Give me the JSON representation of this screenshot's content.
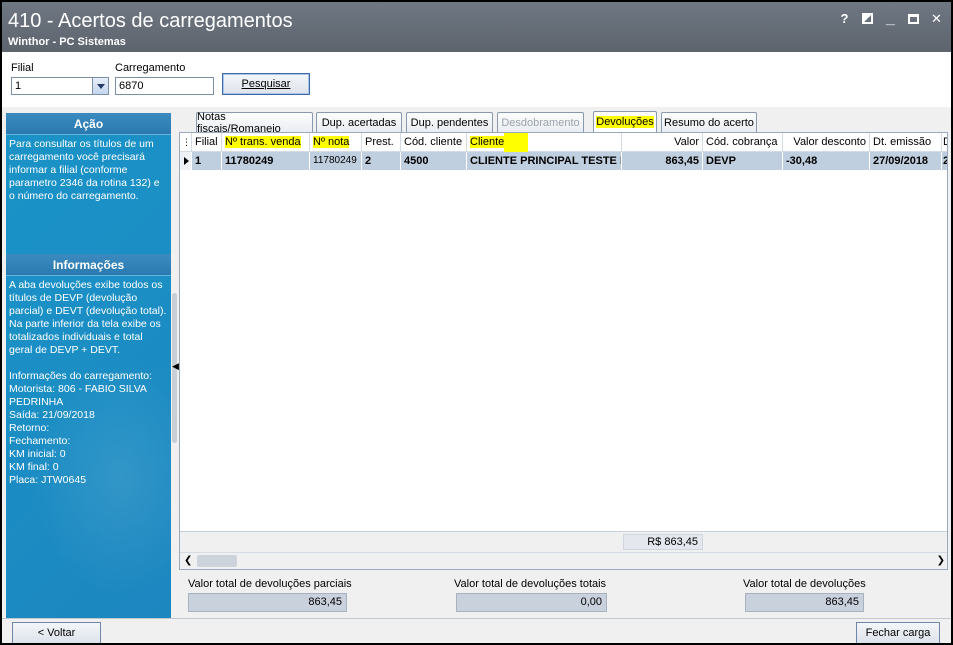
{
  "window": {
    "title": "410 - Acertos de carregamentos",
    "subtitle": "Winthor - PC Sistemas",
    "help_glyph": "?",
    "close_glyph": "✕"
  },
  "filters": {
    "filial_label": "Filial",
    "filial_value": "1",
    "carregamento_label": "Carregamento",
    "carregamento_value": "6870",
    "search_button": "Pesquisar"
  },
  "sidebar": {
    "acao_title": "Ação",
    "acao_text": "Para consultar os títulos de um carregamento você precisará informar a filial (conforme parametro 2346 da rotina 132) e o número do carregamento.",
    "info_title": "Informações",
    "info_text": "A aba devoluções exibe todos os títulos de DEVP (devolução parcial) e DEVT (devolução total).\nNa parte inferior da tela exibe os totalizados individuais e total geral de DEVP + DEVT.\n\nInformações do carregamento:\nMotorista: 806 - FABIO SILVA PEDRINHA\nSaída: 21/09/2018\nRetorno:\nFechamento:\nKM inicial: 0\nKM final: 0\nPlaca: JTW0645"
  },
  "tabs": [
    {
      "label": "Notas fiscais/Romaneio"
    },
    {
      "label": "Dup. acertadas"
    },
    {
      "label": "Dup. pendentes"
    },
    {
      "label": "Desdobramento"
    },
    {
      "label": "Devoluções"
    },
    {
      "label": "Resumo do acerto"
    }
  ],
  "grid": {
    "columns": [
      "Filial",
      "Nº trans. venda",
      "Nº nota",
      "Prest.",
      "Cód. cliente",
      "Cliente",
      "Valor",
      "Cód. cobrança",
      "Valor desconto",
      "Dt. emissão",
      "D"
    ],
    "rows": [
      [
        "1",
        "11780249",
        "11780249",
        "2",
        "4500",
        "CLIENTE PRINCIPAL TESTE L",
        "863,45",
        "DEVP",
        "-30,48",
        "27/09/2018",
        "2"
      ]
    ],
    "sum_value": "R$ 863,45"
  },
  "totals": {
    "parciais_label": "Valor total de devoluções parciais",
    "parciais_value": "863,45",
    "totais_label": "Valor total de devoluções totais",
    "totais_value": "0,00",
    "geral_label": "Valor total de devoluções",
    "geral_value": "863,45"
  },
  "footer": {
    "back_button": "< Voltar",
    "close_button": "Fechar carga"
  }
}
